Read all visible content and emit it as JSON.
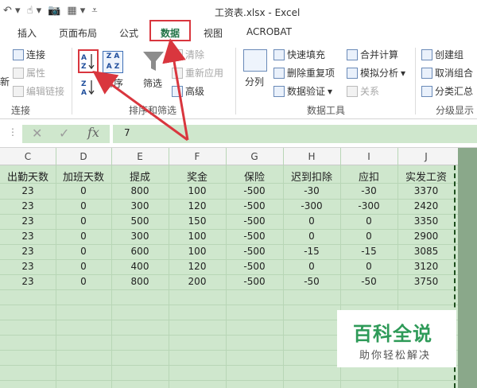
{
  "window": {
    "title": "工资表.xlsx - Excel"
  },
  "tabs": [
    "插入",
    "页面布局",
    "公式",
    "数据",
    "视图",
    "ACROBAT"
  ],
  "active_tab": "数据",
  "ribbon": {
    "connections": {
      "items": [
        "连接",
        "属性",
        "编辑链接"
      ],
      "group_label": "连接",
      "left_cut": "新"
    },
    "sort_filter": {
      "sort_label": "排序",
      "filter_label": "筛选",
      "clear_label": "清除",
      "reapply_label": "重新应用",
      "advanced_label": "高级",
      "group_label": "排序和筛选"
    },
    "data_tools": {
      "split_label": "分列",
      "flash_fill": "快速填充",
      "remove_dup": "删除重复项",
      "validation": "数据验证",
      "consolidate": "合并计算",
      "whatif": "模拟分析",
      "relations": "关系",
      "group_label": "数据工具"
    },
    "outline": {
      "group": "创建组",
      "ungroup": "取消组合",
      "subtotal": "分类汇总",
      "group_label": "分级显示"
    }
  },
  "formula_bar": {
    "value": "7"
  },
  "columns": [
    "C",
    "D",
    "E",
    "F",
    "G",
    "H",
    "I",
    "J"
  ],
  "table": {
    "headers": [
      "出勤天数",
      "加班天数",
      "提成",
      "奖金",
      "保险",
      "迟到扣除",
      "应扣",
      "实发工资"
    ],
    "rows": [
      [
        "23",
        "0",
        "800",
        "100",
        "-500",
        "-30",
        "-30",
        "3370"
      ],
      [
        "23",
        "0",
        "300",
        "120",
        "-500",
        "-300",
        "-300",
        "2420"
      ],
      [
        "23",
        "0",
        "500",
        "150",
        "-500",
        "0",
        "0",
        "3350"
      ],
      [
        "23",
        "0",
        "300",
        "100",
        "-500",
        "0",
        "0",
        "2900"
      ],
      [
        "23",
        "0",
        "600",
        "100",
        "-500",
        "-15",
        "-15",
        "3085"
      ],
      [
        "23",
        "0",
        "400",
        "120",
        "-500",
        "0",
        "0",
        "3120"
      ],
      [
        "23",
        "0",
        "800",
        "200",
        "-500",
        "-50",
        "-50",
        "3750"
      ]
    ]
  },
  "watermark": {
    "title": "百科全说",
    "subtitle": "助你轻松解决"
  },
  "colors": {
    "accent": "#217346",
    "highlight": "#d9363e",
    "selection": "#cfe7cd"
  }
}
